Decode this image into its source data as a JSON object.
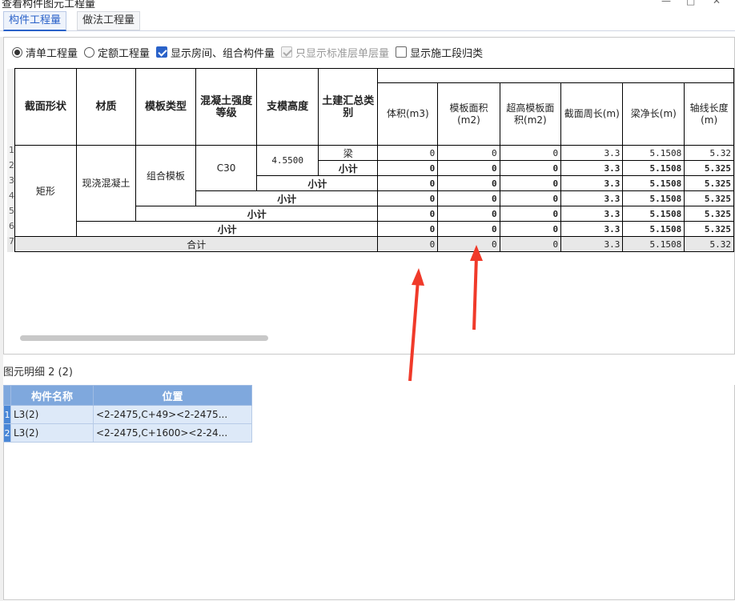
{
  "window": {
    "title": "查看构件图元工程量",
    "minimize": "—",
    "maximize": "□",
    "close": "✕"
  },
  "tabs": [
    "构件工程量",
    "做法工程量"
  ],
  "options": {
    "radio_bill": "清单工程量",
    "radio_quota": "定额工程量",
    "chk_show_room": "显示房间、组合构件量",
    "chk_std_floor": "只显示标准层单层量",
    "chk_stage": "显示施工段归类"
  },
  "table": {
    "headers": [
      "截面形状",
      "材质",
      "模板类型",
      "混凝土强度等级",
      "支模高度",
      "土建汇总类别",
      "体积(m3)",
      "模板面积(m2)",
      "超高模板面积(m2)",
      "截面周长(m)",
      "梁净长(m)",
      "轴线长度(m)"
    ],
    "row_numbers": [
      "1",
      "2",
      "3",
      "4",
      "5",
      "6",
      "7"
    ],
    "cells": {
      "shape": "矩形",
      "material": "现浇混凝土",
      "formwork": "组合模板",
      "grade": "C30",
      "height": "4.5500",
      "category": "梁",
      "subtotal": "小计",
      "total": "合计"
    },
    "values": [
      [
        "0",
        "0",
        "0",
        "3.3",
        "5.1508",
        "5.32"
      ],
      [
        "0",
        "0",
        "0",
        "3.3",
        "5.1508",
        "5.325"
      ],
      [
        "0",
        "0",
        "0",
        "3.3",
        "5.1508",
        "5.325"
      ],
      [
        "0",
        "0",
        "0",
        "3.3",
        "5.1508",
        "5.325"
      ],
      [
        "0",
        "0",
        "0",
        "3.3",
        "5.1508",
        "5.325"
      ],
      [
        "0",
        "0",
        "0",
        "3.3",
        "5.1508",
        "5.325"
      ],
      [
        "0",
        "0",
        "0",
        "3.3",
        "5.1508",
        "5.32"
      ]
    ]
  },
  "detail": {
    "label": "图元明细  2 (2)",
    "headers": [
      "构件名称",
      "位置"
    ],
    "rows": [
      {
        "num": "1",
        "name": "L3(2)",
        "pos": "<2-2475,C+49><2-2475..."
      },
      {
        "num": "2",
        "name": "L3(2)",
        "pos": "<2-2475,C+1600><2-24..."
      }
    ]
  },
  "colors": {
    "accent": "#2a62c9",
    "detail_header": "#7fa8dd",
    "detail_row": "#dde9f8",
    "arrow": "#f03a2a"
  }
}
